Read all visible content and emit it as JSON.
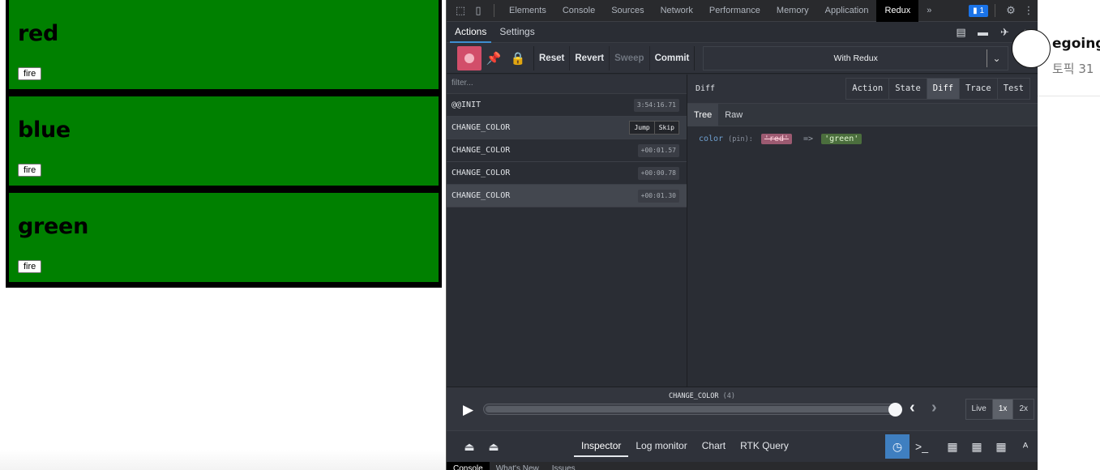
{
  "app": {
    "boxes": [
      {
        "label": "red",
        "button": "fire"
      },
      {
        "label": "blue",
        "button": "fire"
      },
      {
        "label": "green",
        "button": "fire"
      }
    ],
    "box_color": "#008000"
  },
  "devtools": {
    "tabs": [
      "Elements",
      "Console",
      "Sources",
      "Network",
      "Performance",
      "Memory",
      "Application",
      "Redux"
    ],
    "active_tab": "Redux",
    "more": "»",
    "badge": "1",
    "drawer_tabs": [
      "Console",
      "What's New",
      "Issues"
    ]
  },
  "redux": {
    "header_tabs": [
      "Actions",
      "Settings"
    ],
    "toolbar": {
      "reset": "Reset",
      "revert": "Revert",
      "sweep": "Sweep",
      "commit": "Commit",
      "instance": "With Redux"
    },
    "filter_placeholder": "filter...",
    "actions": [
      {
        "name": "@@INIT",
        "time": "3:54:16.71"
      },
      {
        "name": "CHANGE_COLOR",
        "jump": "Jump",
        "skip": "Skip"
      },
      {
        "name": "CHANGE_COLOR",
        "time": "+00:01.57"
      },
      {
        "name": "CHANGE_COLOR",
        "time": "+00:00.78"
      },
      {
        "name": "CHANGE_COLOR",
        "time": "+00:01.30"
      }
    ],
    "monitor": {
      "title": "Diff",
      "tabs": [
        "Action",
        "State",
        "Diff",
        "Trace",
        "Test"
      ],
      "active": "Diff",
      "sub_tabs": [
        "Tree",
        "Raw"
      ],
      "diff": {
        "key": "color",
        "pin": "(pin):",
        "old": "'red'",
        "arrow": "=>",
        "new": "'green'"
      }
    },
    "slider": {
      "label": "CHANGE_COLOR",
      "count": "(4)",
      "speeds": [
        "Live",
        "1x",
        "2x"
      ],
      "active_speed": "1x"
    },
    "bottom_menu": [
      "Inspector",
      "Log monitor",
      "Chart",
      "RTK Query"
    ]
  },
  "side_page": {
    "username": "egoing",
    "topic": "토픽 31"
  }
}
